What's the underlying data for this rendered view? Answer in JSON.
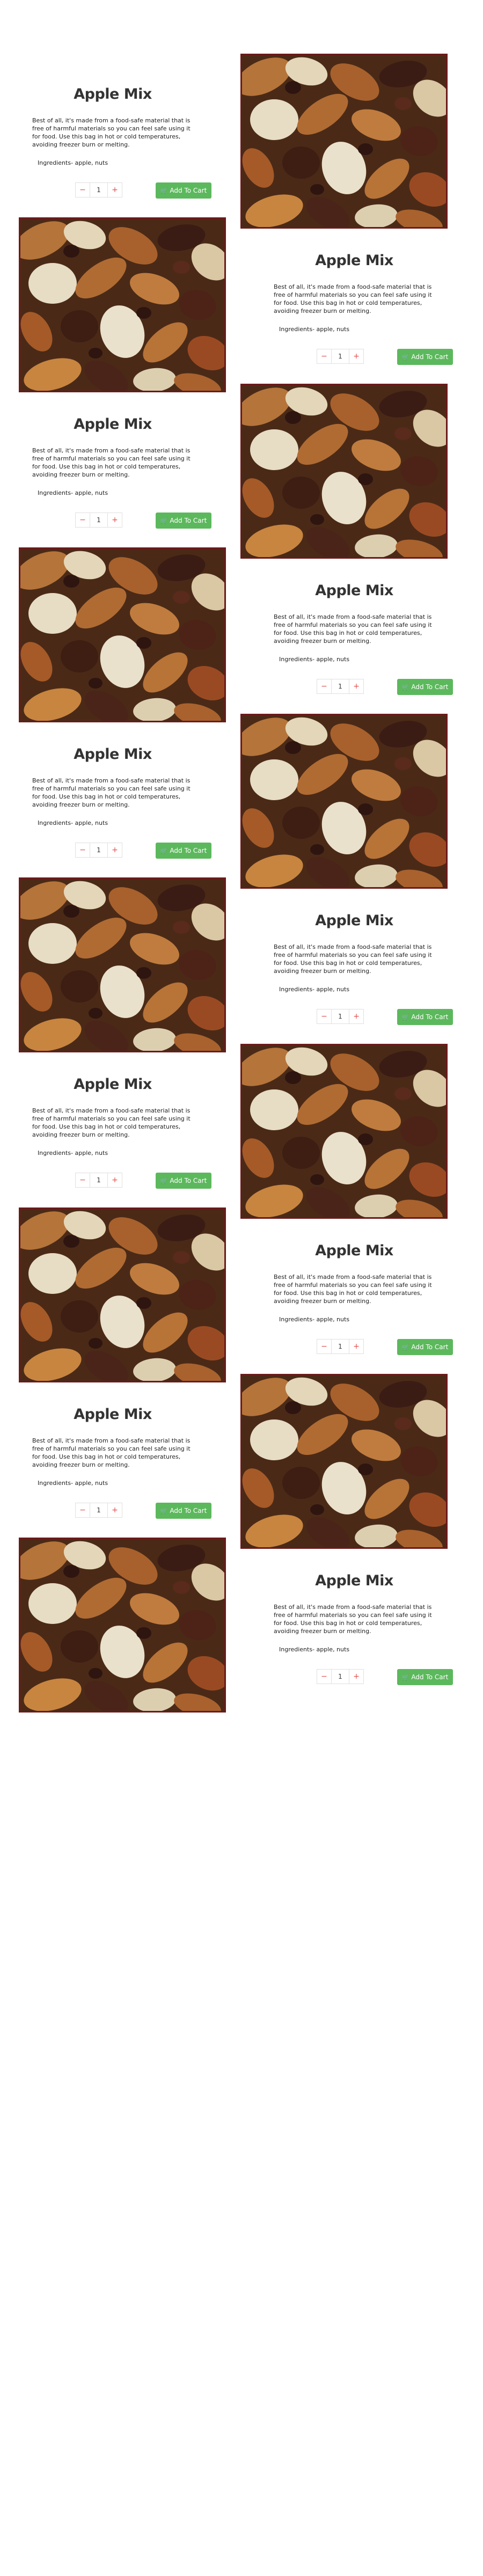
{
  "products": [
    {
      "title": "Apple Mix",
      "description": "Best of all, it's made from a food-safe material that is free of harmful materials so you can feel safe using it for food. Use this bag in hot or cold temperatures, avoiding freezer burn or melting.",
      "ingredients": "Ingredients- apple, nuts",
      "quantity": "1",
      "minus": "−",
      "plus": "+",
      "cart_label": "Add To Cart",
      "image_side": "right"
    },
    {
      "title": "Apple Mix",
      "description": "Best of all, it's made from a food-safe material that is free of harmful materials so you can feel safe using it for food. Use this bag in hot or cold temperatures, avoiding freezer burn or melting.",
      "ingredients": "Ingredients- apple, nuts",
      "quantity": "1",
      "minus": "−",
      "plus": "+",
      "cart_label": "Add To Cart",
      "image_side": "left"
    },
    {
      "title": "Apple Mix",
      "description": "Best of all, it's made from a food-safe material that is free of harmful materials so you can feel safe using it for food. Use this bag in hot or cold temperatures, avoiding freezer burn or melting.",
      "ingredients": "Ingredients- apple, nuts",
      "quantity": "1",
      "minus": "−",
      "plus": "+",
      "cart_label": "Add To Cart",
      "image_side": "right"
    },
    {
      "title": "Apple Mix",
      "description": "Best of all, it's made from a food-safe material that is free of harmful materials so you can feel safe using it for food. Use this bag in hot or cold temperatures, avoiding freezer burn or melting.",
      "ingredients": "Ingredients- apple, nuts",
      "quantity": "1",
      "minus": "−",
      "plus": "+",
      "cart_label": "Add To Cart",
      "image_side": "left"
    },
    {
      "title": "Apple Mix",
      "description": "Best of all, it's made from a food-safe material that is free of harmful materials so you can feel safe using it for food. Use this bag in hot or cold temperatures, avoiding freezer burn or melting.",
      "ingredients": "Ingredients- apple, nuts",
      "quantity": "1",
      "minus": "−",
      "plus": "+",
      "cart_label": "Add To Cart",
      "image_side": "right"
    },
    {
      "title": "Apple Mix",
      "description": "Best of all, it's made from a food-safe material that is free of harmful materials so you can feel safe using it for food. Use this bag in hot or cold temperatures, avoiding freezer burn or melting.",
      "ingredients": "Ingredients- apple, nuts",
      "quantity": "1",
      "minus": "−",
      "plus": "+",
      "cart_label": "Add To Cart",
      "image_side": "left"
    },
    {
      "title": "Apple Mix",
      "description": "Best of all, it's made from a food-safe material that is free of harmful materials so you can feel safe using it for food. Use this bag in hot or cold temperatures, avoiding freezer burn or melting.",
      "ingredients": "Ingredients- apple, nuts",
      "quantity": "1",
      "minus": "−",
      "plus": "+",
      "cart_label": "Add To Cart",
      "image_side": "right"
    },
    {
      "title": "Apple Mix",
      "description": "Best of all, it's made from a food-safe material that is free of harmful materials so you can feel safe using it for food. Use this bag in hot or cold temperatures, avoiding freezer burn or melting.",
      "ingredients": "Ingredients- apple, nuts",
      "quantity": "1",
      "minus": "−",
      "plus": "+",
      "cart_label": "Add To Cart",
      "image_side": "left"
    },
    {
      "title": "Apple Mix",
      "description": "Best of all, it's made from a food-safe material that is free of harmful materials so you can feel safe using it for food. Use this bag in hot or cold temperatures, avoiding freezer burn or melting.",
      "ingredients": "Ingredients- apple, nuts",
      "quantity": "1",
      "minus": "−",
      "plus": "+",
      "cart_label": "Add To Cart",
      "image_side": "right"
    },
    {
      "title": "Apple Mix",
      "description": "Best of all, it's made from a food-safe material that is free of harmful materials so you can feel safe using it for food. Use this bag in hot or cold temperatures, avoiding freezer burn or melting.",
      "ingredients": "Ingredients- apple, nuts",
      "quantity": "1",
      "minus": "−",
      "plus": "+",
      "cart_label": "Add To Cart",
      "image_side": "left"
    }
  ],
  "colors": {
    "cart_button": "#5cb85c",
    "image_border": "#6b1a1a",
    "stepper_symbol": "#e05050"
  },
  "icons": {
    "cart": "shopping-cart-icon"
  }
}
